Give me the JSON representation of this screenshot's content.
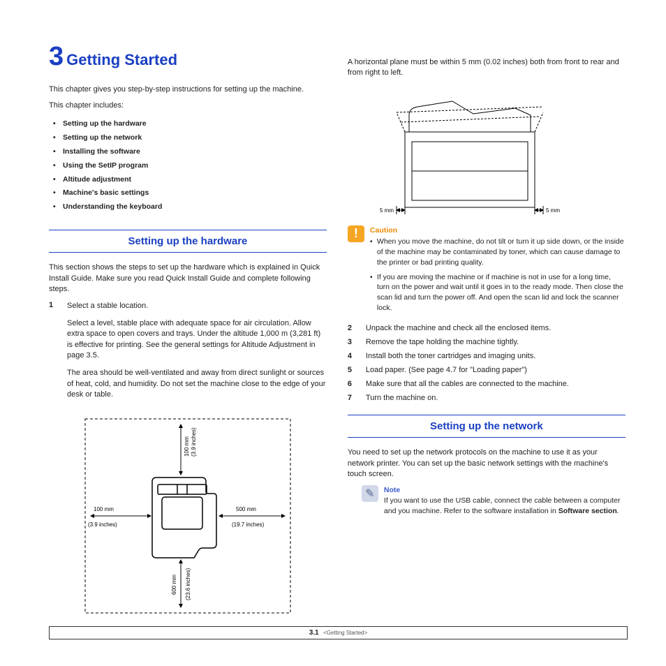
{
  "chapter": {
    "number": "3",
    "title": "Getting Started"
  },
  "intro1": "This chapter gives you step-by-step instructions for setting up the machine.",
  "intro2": "This chapter includes:",
  "toc": [
    "Setting up the hardware",
    "Setting up the network",
    "Installing the software",
    "Using the SetIP program",
    "Altitude adjustment",
    "Machine's basic settings",
    "Understanding the keyboard"
  ],
  "section1": {
    "title": "Setting up the hardware",
    "intro": "This section shows the steps to set up the hardware which is explained in Quick Install Guide. Make sure you read Quick Install Guide and complete following steps.",
    "step1_num": "1",
    "step1_lead": "Select a stable location.",
    "step1_p1": "Select a level, stable place with adequate space for air circulation. Allow extra space to open covers and trays. Under the altitude 1,000 m (3,281 ft) is effective for printing. See the general settings for Altitude Adjustment in page 3.5.",
    "step1_p2": "The area should be well-ventilated and away from direct sunlight or sources of heat, cold, and humidity. Do not set the machine close to the edge of your desk or table."
  },
  "fig1_labels": {
    "top_mm": "100 mm",
    "top_in": "(3.9 inches)",
    "left_mm": "100 mm",
    "left_in": "(3.9 inches)",
    "right_mm": "500 mm",
    "right_in": "(19.7 inches)",
    "bottom_mm": "600 mm",
    "bottom_in": "(23.6 inches)"
  },
  "col2_top": "A horizontal plane must be within 5 mm (0.02 inches) both from front to rear and from right to left.",
  "fig2_labels": {
    "left": "5 mm",
    "right": "5 mm"
  },
  "caution": {
    "title": "Caution",
    "b1": "When you move the machine, do not tilt or turn it up side down, or the inside of the machine may be contaminated by toner, which can cause damage to the printer or bad printing quality.",
    "b2": "If you are moving the machine or if machine is not in use for a long time, turn on the power and wait until it goes in to the ready mode. Then close the scan lid and turn the power off. And open the scan lid and lock the scanner lock."
  },
  "steps2to7": [
    {
      "n": "2",
      "t": "Unpack the machine and check all the enclosed items."
    },
    {
      "n": "3",
      "t": "Remove the tape holding the machine tightly."
    },
    {
      "n": "4",
      "t": "Install both the toner cartridges and imaging units."
    },
    {
      "n": "5",
      "t": "Load paper. (See  page 4.7 for \"Loading paper\")"
    },
    {
      "n": "6",
      "t": "Make sure that all the cables are connected to the machine."
    },
    {
      "n": "7",
      "t": "Turn the machine on."
    }
  ],
  "section2": {
    "title": "Setting up the network",
    "intro": "You need to set up the network protocols on the machine to use it as your network printer. You can set up the basic network settings with the machine's touch screen."
  },
  "note": {
    "title": "Note",
    "text_a": "If you want to use the USB cable, connect the cable between a computer and you machine. Refer to the software installation in ",
    "text_b": "Software section",
    "text_c": "."
  },
  "footer": {
    "page_chapter": "3",
    "page_num": ".1",
    "label": "<Getting Started>"
  }
}
